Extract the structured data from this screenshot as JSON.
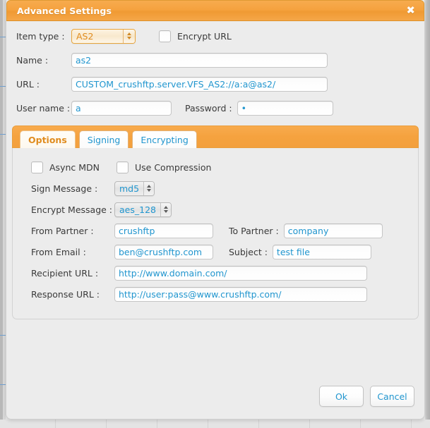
{
  "window": {
    "title": "Advanced Settings",
    "close_icon": "close-icon",
    "close_glyph": "✖"
  },
  "colors": {
    "accent_orange": "#f5a23f",
    "link_blue": "#2196cf",
    "label_gray": "#3a3a3a",
    "panel_gray": "#ececec"
  },
  "form": {
    "item_type": {
      "label": "Item type :",
      "value": "AS2"
    },
    "encrypt_url": {
      "label": "Encrypt URL",
      "checked": false
    },
    "name": {
      "label": "Name :",
      "value": "as2"
    },
    "url": {
      "label": "URL :",
      "value": "CUSTOM_crushftp.server.VFS_AS2://a:a@as2/"
    },
    "user_name": {
      "label": "User name :",
      "value": "a"
    },
    "password": {
      "label": "Password :",
      "value": "•"
    }
  },
  "tabs": [
    {
      "label": "Options",
      "active": true
    },
    {
      "label": "Signing",
      "active": false
    },
    {
      "label": "Encrypting",
      "active": false
    }
  ],
  "options_tab": {
    "async_mdn": {
      "label": "Async MDN",
      "checked": false
    },
    "use_compression": {
      "label": "Use Compression",
      "checked": false
    },
    "sign_message": {
      "label": "Sign Message :",
      "value": "md5"
    },
    "encrypt_message": {
      "label": "Encrypt Message :",
      "value": "aes_128"
    },
    "from_partner": {
      "label": "From Partner :",
      "value": "crushftp"
    },
    "to_partner": {
      "label": "To Partner :",
      "value": "company"
    },
    "from_email": {
      "label": "From Email :",
      "value": "ben@crushftp.com"
    },
    "subject": {
      "label": "Subject :",
      "value": "test file"
    },
    "recipient_url": {
      "label": "Recipient URL :",
      "value": "http://www.domain.com/"
    },
    "response_url": {
      "label": "Response URL :",
      "value": "http://user:pass@www.crushftp.com/"
    }
  },
  "footer": {
    "ok_label": "Ok",
    "cancel_label": "Cancel"
  }
}
